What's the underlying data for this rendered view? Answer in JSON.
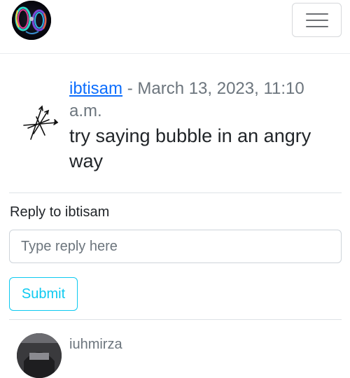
{
  "navbar": {
    "logo_icon": "bubble-logo-icon",
    "toggler_icon": "hamburger-menu-icon"
  },
  "comment": {
    "avatar_icon": "sketch-arrows-avatar",
    "username": "ibtisam",
    "separator": " - ",
    "timestamp": "March 13, 2023, 11:10 a.m.",
    "text": "try saying bubble in an angry way"
  },
  "reply_form": {
    "label": "Reply to ibtisam",
    "placeholder": "Type reply here",
    "submit_label": "Submit"
  },
  "next_comment": {
    "avatar_icon": "user-photo-avatar",
    "username": "iuhmirza"
  },
  "colors": {
    "link": "#0d6efd",
    "muted": "#6c757d",
    "submit_outline": "#0dcaf0",
    "divider": "#dee2e6"
  }
}
